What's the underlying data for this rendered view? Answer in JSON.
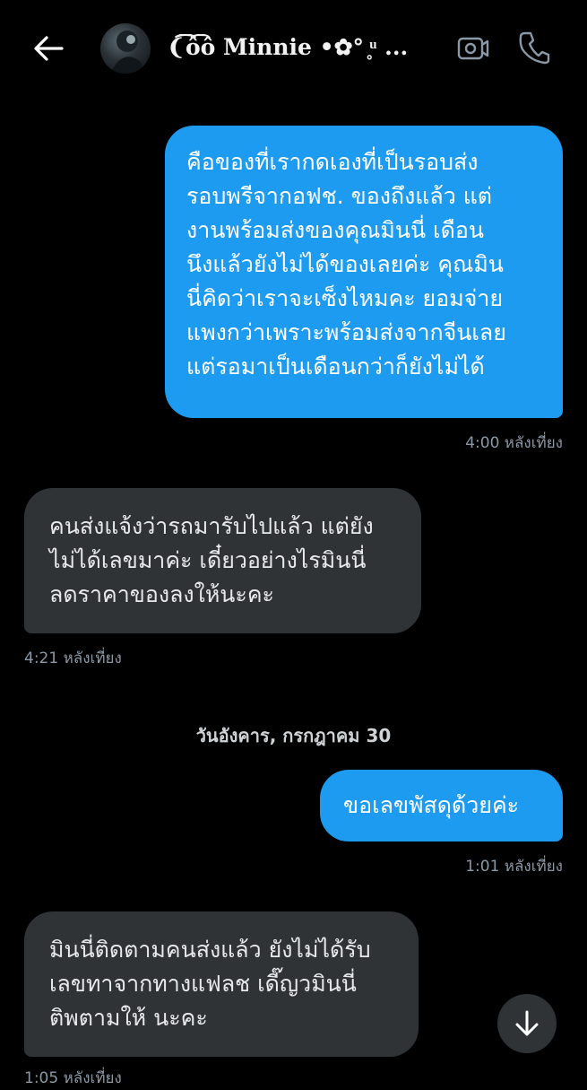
{
  "header": {
    "contact_name": "❨͡ô͡ô Minnie •✿° ̥ͧ ..."
  },
  "messages": [
    {
      "direction": "out",
      "lines": [
        "คือของที่เรากดเองที่เป็นรอบส่ง",
        "รอบพรีจากอฟช. ของถึงแล้ว แต่",
        "งานพร้อมส่งของคุณมินนี่ เดือน",
        "นึงแล้วยังไม่ได้ของเลยค่ะ คุณมิน",
        "นี่คิดว่าเราจะเซ็งไหมคะ ยอมจ่าย",
        "แพงกว่าเพราะพร้อมส่งจากจีนเลย",
        "แต่รอมาเป็นเดือนกว่าก็ยังไม่ได้"
      ],
      "time": "4:00 หลังเที่ยง"
    },
    {
      "direction": "in",
      "lines": [
        "คนส่งแจ้งว่ารถมารับไปแล้ว แต่ยัง",
        "ไม่ได้เลขมาค่ะ เดี๋ยวอย่างไรมินนี่",
        "ลดราคาของลงให้นะคะ"
      ],
      "time": "4:21 หลังเที่ยง"
    },
    {
      "direction": "out",
      "lines": [
        "ขอเลขพัสดุด้วยค่ะ"
      ],
      "time": "1:01 หลังเที่ยง"
    },
    {
      "direction": "in",
      "lines": [
        "มินนี่ติดตามคนส่งแล้ว ยังไม่ได้รับ",
        "เลขทาจากทางแฟลช เดี๊ญวมินนี่",
        "ติพตามให้ นะคะ"
      ],
      "time": "1:05 หลังเที่ยง"
    }
  ],
  "date_separator": "วันอังคาร, กรกฎาคม 30",
  "colors": {
    "outgoing_bubble": "#1d9bf0",
    "incoming_bubble": "#2f3336",
    "background": "#000000",
    "timestamp": "#8b98a5"
  },
  "icons": {
    "back": "arrow-left-icon",
    "video": "video-camera-icon",
    "call": "phone-icon",
    "scroll": "arrow-down-icon"
  }
}
